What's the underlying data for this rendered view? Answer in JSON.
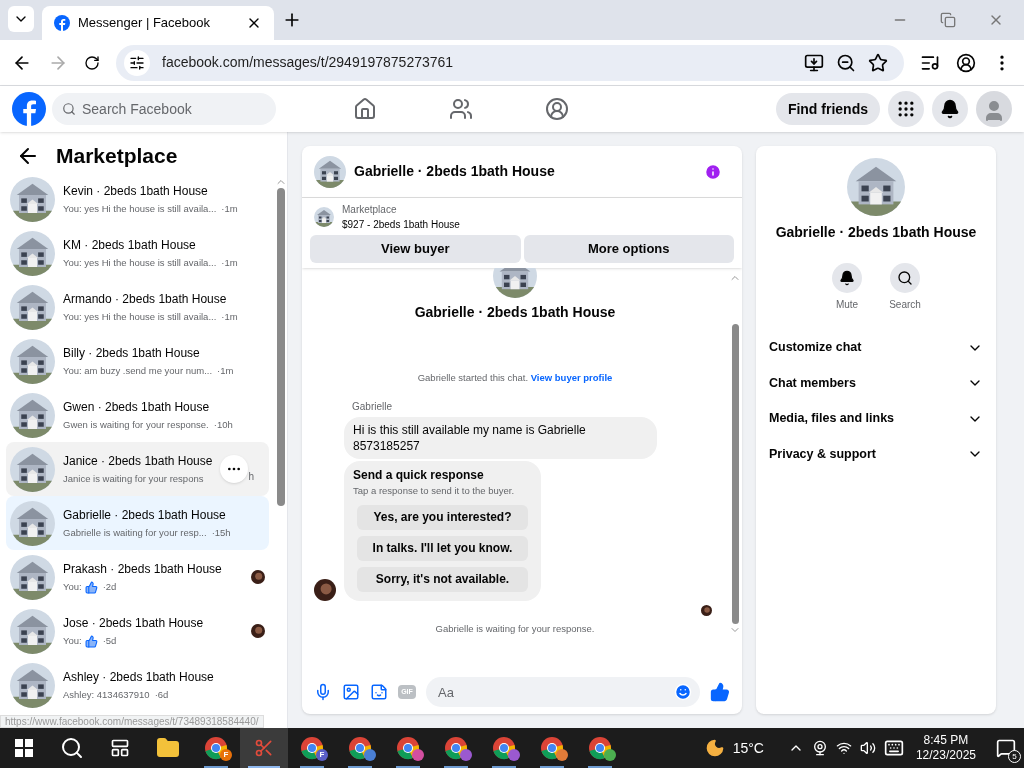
{
  "browser": {
    "tab_title": "Messenger | Facebook",
    "url": "facebook.com/messages/t/2949197875273761",
    "status_url": "https://www.facebook.com/messages/t/73489318584440/"
  },
  "header": {
    "search_placeholder": "Search Facebook",
    "nav": [
      {
        "kind": "home",
        "selected": false
      },
      {
        "kind": "friends",
        "selected": false
      },
      {
        "kind": "groups",
        "selected": false
      }
    ],
    "find_friends": "Find friends"
  },
  "sidebar": {
    "title": "Marketplace",
    "conversations": [
      {
        "name": "Kevin · 2beds 1bath House",
        "preview": "You: yes Hi the house is still availa...",
        "time": "·1m",
        "selected": false,
        "hovered": false,
        "like": false,
        "seen": false
      },
      {
        "name": "KM · 2beds 1bath House",
        "preview": "You: yes Hi the house is still availa...",
        "time": "·1m",
        "selected": false,
        "hovered": false,
        "like": false,
        "seen": false
      },
      {
        "name": "Armando · 2beds 1bath House",
        "preview": "You: yes Hi the house is still availa...",
        "time": "·1m",
        "selected": false,
        "hovered": false,
        "like": false,
        "seen": false
      },
      {
        "name": "Billy · 2beds 1bath House",
        "preview": "You: am buzy .send me your num...",
        "time": "·1m",
        "selected": false,
        "hovered": false,
        "like": false,
        "seen": false
      },
      {
        "name": "Gwen · 2beds 1bath House",
        "preview": "Gwen is waiting for your response.",
        "time": "·10h",
        "selected": false,
        "hovered": false,
        "like": false,
        "seen": false
      },
      {
        "name": "Janice · 2beds 1bath House",
        "preview": "Janice is waiting for your respons",
        "time": "h",
        "selected": false,
        "hovered": true,
        "like": false,
        "seen": false
      },
      {
        "name": "Gabrielle · 2beds 1bath House",
        "preview": "Gabrielle is waiting for your resp...",
        "time": "·15h",
        "selected": true,
        "hovered": false,
        "like": false,
        "seen": false
      },
      {
        "name": "Prakash · 2beds 1bath House",
        "preview": "You:",
        "time": "·2d",
        "selected": false,
        "hovered": false,
        "like": true,
        "seen": true
      },
      {
        "name": "Jose · 2beds 1bath House",
        "preview": "You:",
        "time": "·5d",
        "selected": false,
        "hovered": false,
        "like": true,
        "seen": true
      },
      {
        "name": "Ashley · 2beds 1bath House",
        "preview": "Ashley: 4134637910",
        "time": "·6d",
        "selected": false,
        "hovered": false,
        "like": false,
        "seen": false
      }
    ]
  },
  "chat": {
    "title": "Gabrielle · 2beds 1bath House",
    "listing_label": "Marketplace",
    "listing": "$927 - 2beds 1bath House",
    "buttons": [
      "View buyer",
      "More options"
    ],
    "intro_title": "Gabrielle · 2beds 1bath House",
    "started": "Gabrielle started this chat.",
    "profile_link": "View buyer profile",
    "sender": "Gabrielle",
    "message": "Hi is this still available my name is Gabrielle 8573185257",
    "quick": {
      "title": "Send a quick response",
      "subtitle": "Tap a response to send it to the buyer.",
      "options": [
        "Yes, are you interested?",
        "In talks. I'll let you know.",
        "Sorry, it's not available."
      ]
    },
    "waiting": "Gabrielle is waiting for your response.",
    "gif": "GIF",
    "composer_placeholder": "Aa"
  },
  "details": {
    "name": "Gabrielle · 2beds 1bath House",
    "actions": [
      {
        "kind": "mute",
        "label": "Mute"
      },
      {
        "kind": "search",
        "label": "Search"
      }
    ],
    "sections": [
      {
        "label": "Customize chat",
        "expanded": false
      },
      {
        "label": "Chat members",
        "expanded": false
      },
      {
        "label": "Media, files and links",
        "expanded": false
      },
      {
        "label": "Privacy & support",
        "expanded": false
      }
    ]
  },
  "taskbar": {
    "weather": "15°C",
    "time": "8:45 PM",
    "date": "12/23/2025",
    "notifications": "5",
    "apps": [
      {
        "kind": "chrome",
        "badge": "F",
        "color": "#e8710a",
        "selected": false
      },
      {
        "kind": "snip",
        "selected": true
      },
      {
        "kind": "chrome",
        "badge": "F",
        "color": "#5b5fc7",
        "selected": false
      },
      {
        "kind": "chrome",
        "color": "#4a7fd4",
        "selected": false
      },
      {
        "kind": "chrome",
        "color": "#d34fa0",
        "selected": false
      },
      {
        "kind": "chrome",
        "color": "#9b59d0",
        "selected": false
      },
      {
        "kind": "chrome",
        "color": "#9b59d0",
        "selected": false
      },
      {
        "kind": "chrome",
        "color": "#e07b39",
        "selected": false
      },
      {
        "kind": "chrome",
        "color": "#4caf50",
        "selected": false
      }
    ]
  }
}
